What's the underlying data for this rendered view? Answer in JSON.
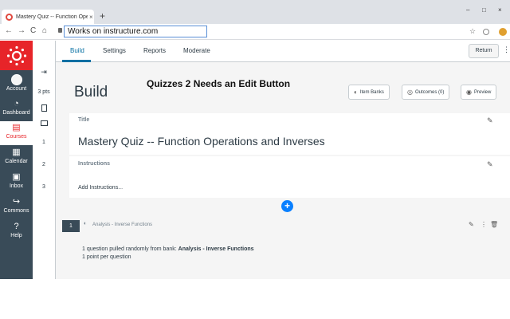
{
  "browser": {
    "tab_title": "Mastery Quiz -- Function Operati",
    "tab_close": "×",
    "new_tab": "+",
    "address": "Works on instructure.com",
    "back": "←",
    "forward": "→",
    "reload": "C",
    "home": "⌂",
    "star": "☆",
    "minimize": "–",
    "maximize": "□",
    "close": "×"
  },
  "global_nav": {
    "items": [
      {
        "label": "Account",
        "icon": "avatar-icon"
      },
      {
        "label": "Dashboard",
        "icon": "dashboard-icon"
      },
      {
        "label": "Courses",
        "icon": "courses-icon"
      },
      {
        "label": "Calendar",
        "icon": "calendar-icon"
      },
      {
        "label": "Inbox",
        "icon": "inbox-icon"
      },
      {
        "label": "Commons",
        "icon": "commons-icon"
      },
      {
        "label": "Help",
        "icon": "help-icon"
      }
    ],
    "brand_color": "#e72429",
    "bg_color": "#394b58"
  },
  "quiz_sidebar": {
    "points": "3 pts",
    "questions": [
      "1",
      "2",
      "3"
    ]
  },
  "appbar": {
    "tabs": [
      "Build",
      "Settings",
      "Reports",
      "Moderate"
    ],
    "active_tab": "Build",
    "return_label": "Return",
    "kebab": "⋮"
  },
  "main": {
    "heading": "Build",
    "overlay_banner": "Quizzes 2 Needs an Edit Button",
    "buttons": {
      "item_banks": "Item Banks",
      "outcomes": "Outcomes (0)",
      "preview": "Preview"
    },
    "title_label": "Title",
    "quiz_title": "Mastery Quiz -- Function Operations and Inverses",
    "instructions_label": "Instructions",
    "instructions_placeholder": "Add Instructions...",
    "bank_item": {
      "number": "1",
      "bank_name": "Analysis - Inverse Functions",
      "pulled_prefix": "1 question pulled randomly from bank:",
      "pulled_bank": "Analysis - Inverse Functions",
      "points_per": "1 point per question"
    },
    "accent_color": "#0770a3"
  }
}
